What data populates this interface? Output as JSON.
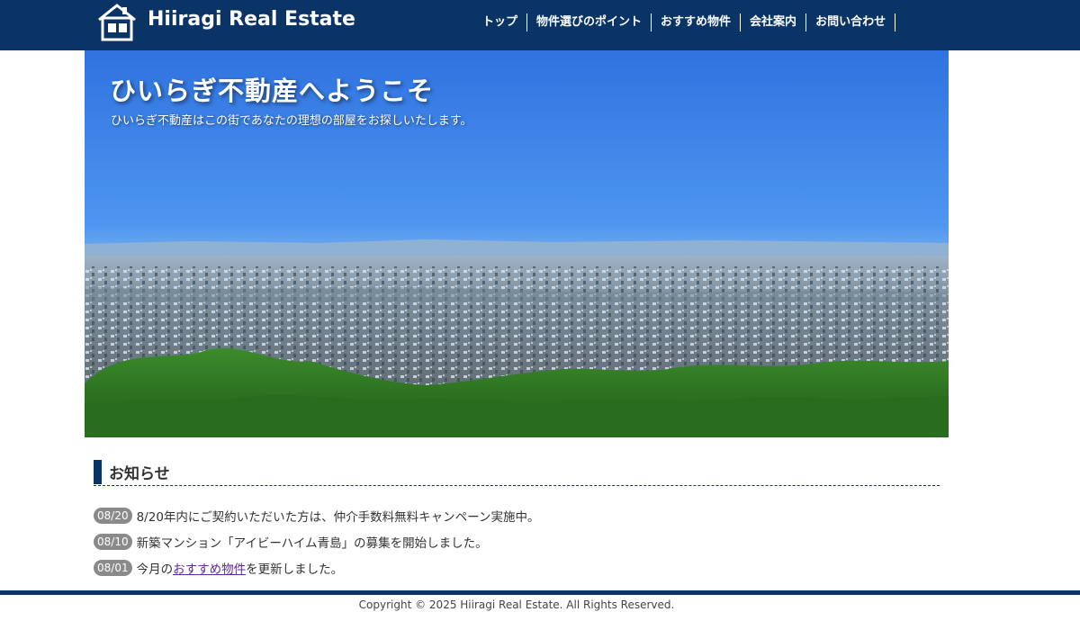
{
  "header": {
    "logo_text": "Hiiragi Real Estate",
    "logo_icon": "house-logo-icon",
    "nav": [
      {
        "label": "トップ"
      },
      {
        "label": "物件選びのポイント"
      },
      {
        "label": "おすすめ物件"
      },
      {
        "label": "会社案内"
      },
      {
        "label": "お問い合わせ"
      }
    ]
  },
  "hero": {
    "title": "ひいらぎ不動産へようこそ",
    "subtitle": "ひいらぎ不動産はこの街であなたの理想の部屋をお探しいたします。"
  },
  "news": {
    "heading": "お知らせ",
    "items": [
      {
        "date": "08/20",
        "text_before": "8/20年内にご契約いただいた方は、仲介手数料無料キャンペーン実施中。",
        "link": "",
        "text_after": ""
      },
      {
        "date": "08/10",
        "text_before": "新築マンション「アイビーハイム青島」の募集を開始しました。",
        "link": "",
        "text_after": ""
      },
      {
        "date": "08/01",
        "text_before": "今月の",
        "link": "おすすめ物件",
        "text_after": "を更新しました。"
      }
    ]
  },
  "footer": {
    "copyright": "Copyright © 2025 Hiiragi Real Estate. All Rights Reserved."
  },
  "colors": {
    "header_bg": "#0b3466",
    "badge_bg": "#8a8a8a",
    "link": "#5b2c8e"
  }
}
